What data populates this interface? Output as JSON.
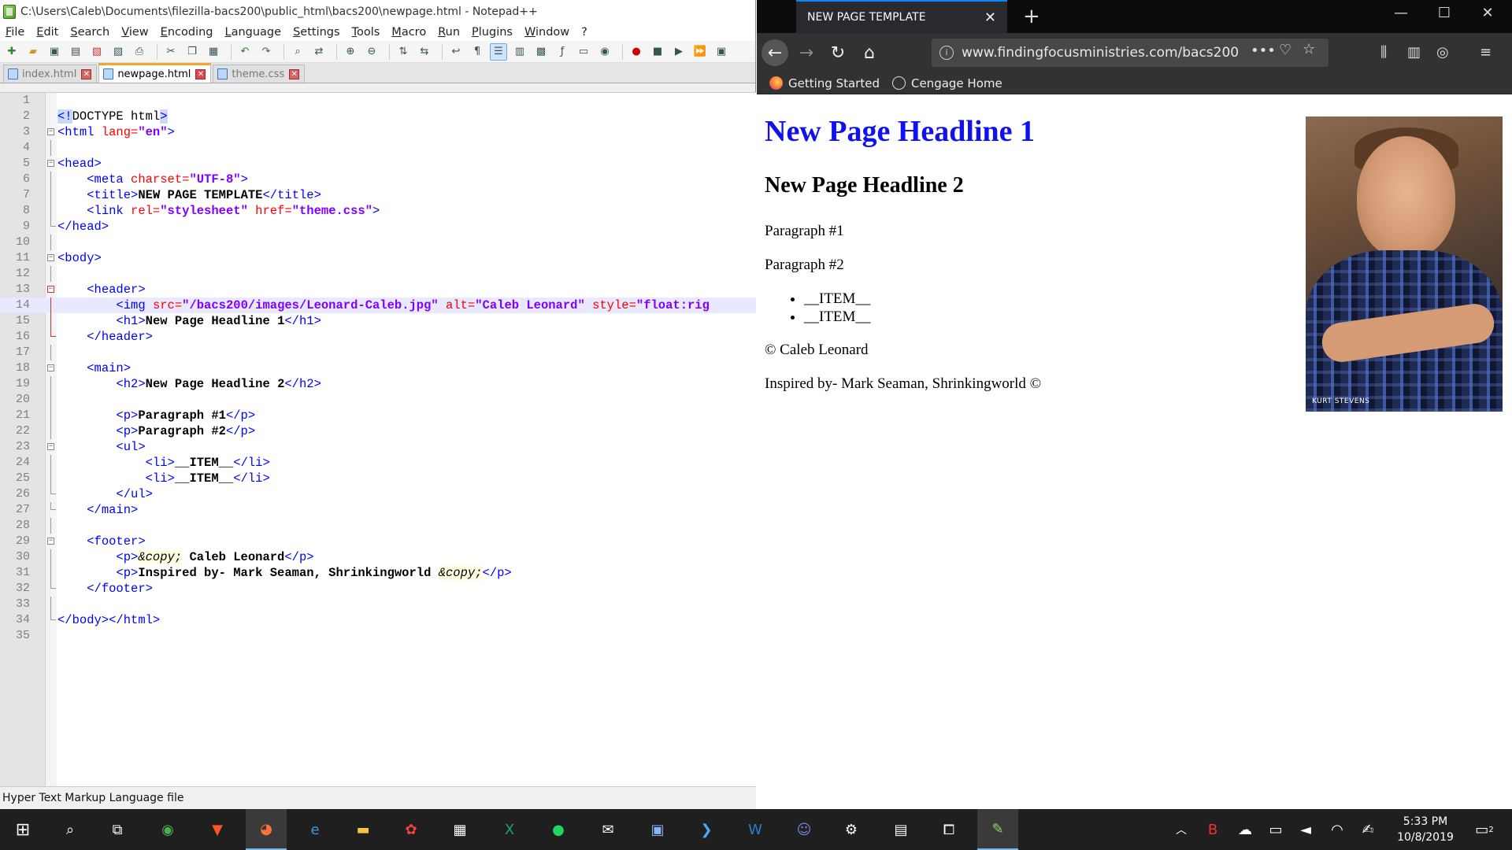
{
  "npp": {
    "title": "C:\\Users\\Caleb\\Documents\\filezilla-bacs200\\public_html\\bacs200\\newpage.html - Notepad++",
    "menu": [
      "File",
      "Edit",
      "Search",
      "View",
      "Encoding",
      "Language",
      "Settings",
      "Tools",
      "Macro",
      "Run",
      "Plugins",
      "Window",
      "?"
    ],
    "tabs": [
      {
        "label": "index.html",
        "active": false
      },
      {
        "label": "newpage.html",
        "active": true
      },
      {
        "label": "theme.css",
        "active": false
      }
    ],
    "line_numbers": [
      "1",
      "2",
      "3",
      "4",
      "5",
      "6",
      "7",
      "8",
      "9",
      "10",
      "11",
      "12",
      "13",
      "14",
      "15",
      "16",
      "17",
      "18",
      "19",
      "20",
      "21",
      "22",
      "23",
      "24",
      "25",
      "26",
      "27",
      "28",
      "29",
      "30",
      "31",
      "32",
      "33",
      "34",
      "35"
    ],
    "code": {
      "l2_a": "<!",
      "l2_b": "DOCTYPE html",
      "l2_c": ">",
      "l3_a": "<html ",
      "l3_b": "lang=",
      "l3_c": "\"en\"",
      "l3_d": ">",
      "l5": "<head>",
      "l6_a": "<meta ",
      "l6_b": "charset=",
      "l6_c": "\"UTF-8\"",
      "l6_d": ">",
      "l7_a": "<title>",
      "l7_b": "NEW PAGE TEMPLATE",
      "l7_c": "</title>",
      "l8_a": "<link ",
      "l8_b": "rel=",
      "l8_c": "\"stylesheet\"",
      "l8_d": " href=",
      "l8_e": "\"theme.css\"",
      "l8_f": ">",
      "l9": "</head>",
      "l11": "<body>",
      "l13": "<header>",
      "l14_a": "<img ",
      "l14_b": "src=",
      "l14_c": "\"/bacs200/images/Leonard-Caleb.jpg\"",
      "l14_d": " alt=",
      "l14_e": "\"Caleb Leonard\"",
      "l14_f": " style=",
      "l14_g": "\"float:rig",
      "l15_a": "<h1>",
      "l15_b": "New Page Headline 1",
      "l15_c": "</h1>",
      "l16": "</header>",
      "l18": "<main>",
      "l19_a": "<h2>",
      "l19_b": "New Page Headline 2",
      "l19_c": "</h2>",
      "l21_a": "<p>",
      "l21_b": "Paragraph #1",
      "l21_c": "</p>",
      "l22_a": "<p>",
      "l22_b": "Paragraph #2",
      "l22_c": "</p>",
      "l23": "<ul>",
      "l24_a": "<li>",
      "l24_b": "__ITEM__",
      "l24_c": "</li>",
      "l25_a": "<li>",
      "l25_b": "__ITEM__",
      "l25_c": "</li>",
      "l26": "</ul>",
      "l27": "</main>",
      "l29": "<footer>",
      "l30_a": "<p>",
      "l30_b": "&copy;",
      "l30_c": " Caleb Leonard",
      "l30_d": "</p>",
      "l31_a": "<p>",
      "l31_b": "Inspired by- Mark Seaman, Shrinkingworld ",
      "l31_c": "&copy;",
      "l31_d": "</p>",
      "l32": "</footer>",
      "l34": "</body></html>"
    },
    "status": "Hyper Text Markup Language file"
  },
  "firefox": {
    "tab_title": "NEW PAGE TEMPLATE",
    "url": "www.findingfocusministries.com/bacs200",
    "bookmarks": [
      "Getting Started",
      "Cengage Home"
    ]
  },
  "page": {
    "h1": "New Page Headline 1",
    "h2": "New Page Headline 2",
    "p1": "Paragraph #1",
    "p2": "Paragraph #2",
    "items": [
      "__ITEM__",
      "__ITEM__"
    ],
    "footer1": "© Caleb Leonard",
    "footer2": "Inspired by- Mark Seaman, Shrinkingworld ©",
    "photo_watermark": "KURT STEVENS"
  },
  "taskbar": {
    "time": "5:33 PM",
    "date": "10/8/2019",
    "notification_count": "2"
  },
  "colors": {
    "tag": "#0000ff",
    "attribute": "#ff0000",
    "value": "#8000ff",
    "h1_link": "#1010f0",
    "accent_tab": "#0a84ff"
  }
}
